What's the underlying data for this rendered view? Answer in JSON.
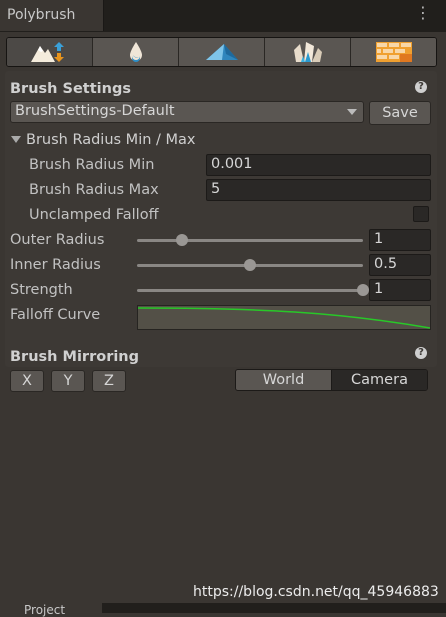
{
  "window": {
    "tab_title": "Polybrush",
    "menu": "⋮"
  },
  "toolbar": {
    "tools": [
      {
        "name": "raise-lower-tool",
        "icon": "mountain-arrows-icon"
      },
      {
        "name": "smooth-tool",
        "icon": "water-drop-icon"
      },
      {
        "name": "paint-tool",
        "icon": "paint-prism-icon"
      },
      {
        "name": "scatter-tool",
        "icon": "crystal-shards-icon"
      },
      {
        "name": "texture-tool",
        "icon": "brick-wall-icon"
      }
    ],
    "active_index": 0
  },
  "brush_settings": {
    "title": "Brush Settings",
    "help": "?",
    "preset": "BrushSettings-Default",
    "save_label": "Save",
    "radius_foldout": "Brush Radius Min / Max",
    "radius_min_label": "Brush Radius Min",
    "radius_min_value": "0.001",
    "radius_max_label": "Brush Radius Max",
    "radius_max_value": "5",
    "unclamped_label": "Unclamped Falloff",
    "unclamped_checked": false,
    "outer_radius_label": "Outer Radius",
    "outer_radius_value": "1",
    "outer_radius_fraction": 0.2,
    "inner_radius_label": "Inner Radius",
    "inner_radius_value": "0.5",
    "inner_radius_fraction": 0.5,
    "strength_label": "Strength",
    "strength_value": "1",
    "strength_fraction": 1.0,
    "falloff_label": "Falloff Curve",
    "curve_color": "#28c828"
  },
  "mirroring": {
    "title": "Brush Mirroring",
    "help": "?",
    "axes": [
      "X",
      "Y",
      "Z"
    ],
    "space_options": [
      "World",
      "Camera"
    ],
    "selected_space": "Camera"
  },
  "footer": {
    "watermark": "https://blog.csdn.net/qq_45946883",
    "bottom_tab": "Project"
  }
}
